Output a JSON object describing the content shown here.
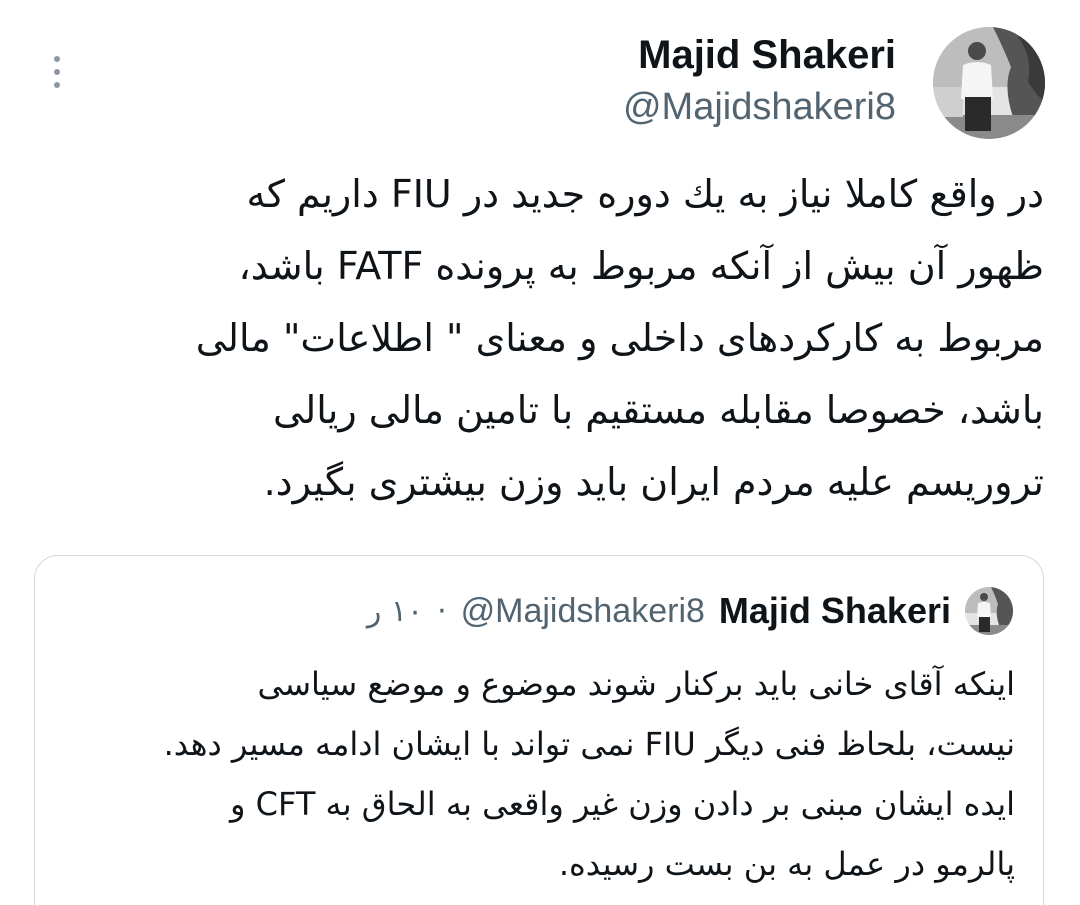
{
  "tweet": {
    "author_name": "Majid Shakeri",
    "author_handle": "@Majidshakeri8",
    "body_lines": [
      "در واقع کاملا نیاز به یك دوره جدید در FIU داریم که",
      "ظهور آن بیش از آنکه مربوط به پرونده FATF باشد،",
      "مربوط به کارکردهای داخلی و معنای \" اطلاعات\" مالی",
      "باشد، خصوصا مقابله مستقیم با تامین مالی ریالی",
      "تروریسم علیه مردم ایران باید وزن بیشتری بگیرد."
    ]
  },
  "quote": {
    "author_name": "Majid Shakeri",
    "author_handle": "@Majidshakeri8",
    "separator": "·",
    "time": "۱۰ ر",
    "body_lines": [
      "اینکه آقای خانی باید برکنار شوند موضوع و موضع سیاسی",
      "نیست، بلحاظ فنی دیگر FIU نمی تواند با ایشان ادامه مسیر دهد.",
      "ایده ایشان مبنی بر دادن وزن غیر واقعی به  الحاق به CFT و",
      "پالرمو در عمل به بن بست رسیده."
    ]
  },
  "icons": {
    "more": "more-vertical-icon"
  },
  "colors": {
    "text_primary": "#0f1419",
    "text_secondary": "#536471",
    "border": "#cfd9de",
    "background": "#ffffff"
  }
}
